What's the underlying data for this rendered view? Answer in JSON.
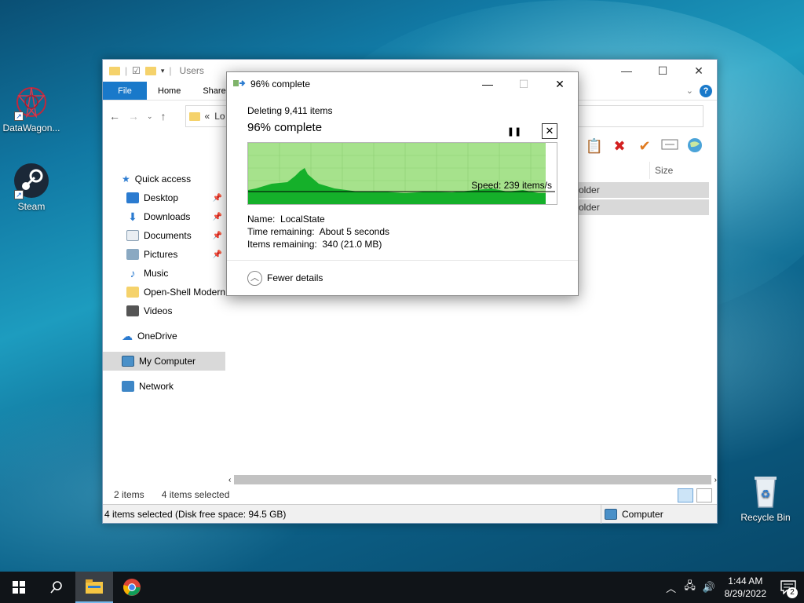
{
  "desktop": {
    "icons": [
      {
        "label": "DataWagon..."
      },
      {
        "label": "Steam"
      },
      {
        "label": "Recycle Bin"
      }
    ]
  },
  "explorer": {
    "title": "Users",
    "tabs": [
      "File",
      "Home",
      "Share"
    ],
    "address_text": "Lo",
    "nav": {
      "quick_access": "Quick access",
      "items": [
        "Desktop",
        "Downloads",
        "Documents",
        "Pictures",
        "Music",
        "Open-Shell Modern",
        "Videos"
      ],
      "onedrive": "OneDrive",
      "my_computer": "My Computer",
      "network": "Network"
    },
    "column_size": "Size",
    "rows": [
      "older",
      "older"
    ],
    "status": {
      "items": "2 items",
      "selected": "4 items selected",
      "disk": "4 items selected (Disk free space: 94.5 GB)",
      "location": "Computer"
    }
  },
  "dialog": {
    "title": "96% complete",
    "action": "Deleting 9,411 items",
    "percent_label": "96% complete",
    "progress_fraction": 0.96,
    "speed": "Speed: 239 items/s",
    "name_label": "Name:",
    "name_value": "LocalState",
    "time_label": "Time remaining:",
    "time_value": "About 5 seconds",
    "items_label": "Items remaining:",
    "items_value": "340 (21.0 MB)",
    "fewer_details": "Fewer details"
  },
  "taskbar": {
    "time": "1:44 AM",
    "date": "8/29/2022",
    "notifications": "2"
  }
}
